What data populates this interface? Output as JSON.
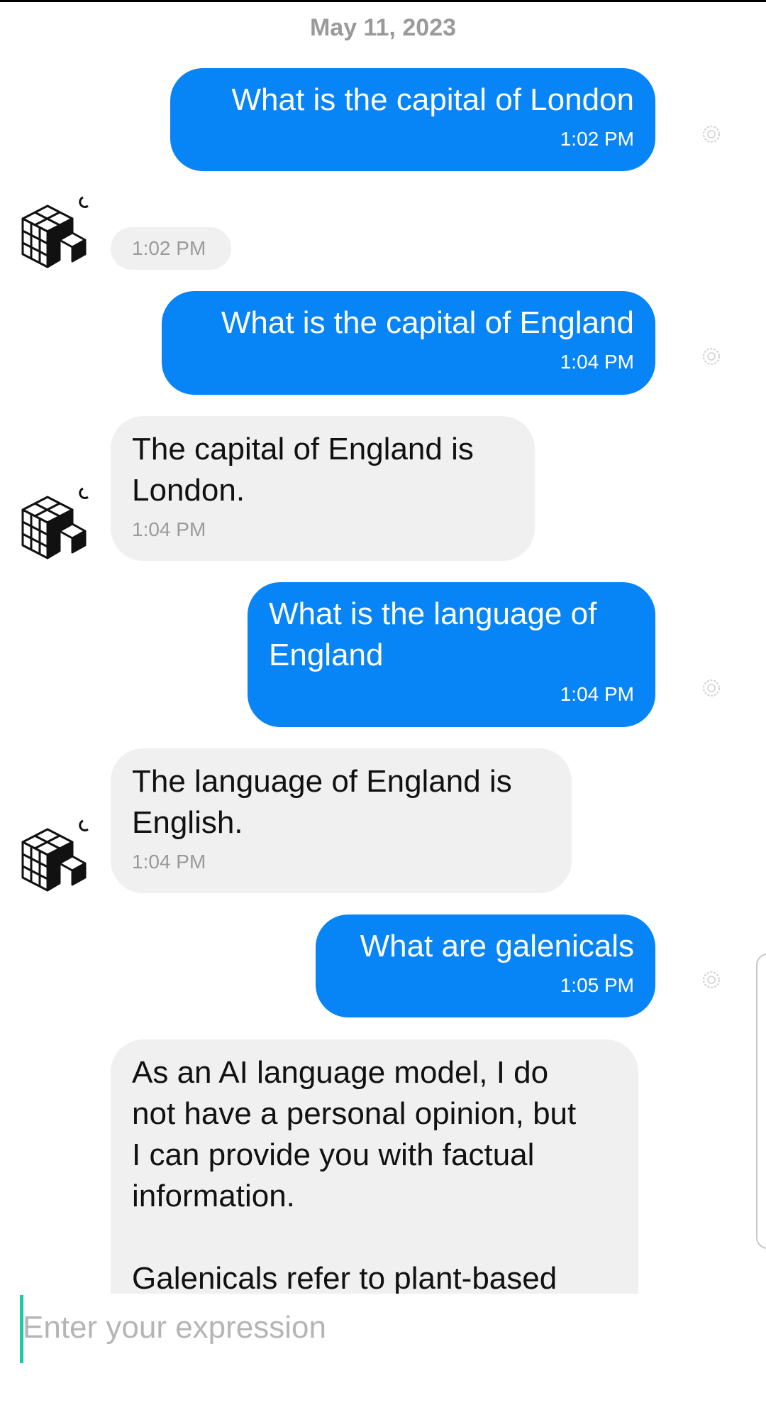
{
  "chat": {
    "date_header": "May 11, 2023",
    "messages": [
      {
        "sender": "user",
        "text": "What is the capital of London",
        "time": "1:02 PM"
      },
      {
        "sender": "bot",
        "text": "",
        "time": "1:02 PM"
      },
      {
        "sender": "user",
        "text": "What is the capital of England",
        "time": "1:04 PM"
      },
      {
        "sender": "bot",
        "text": "The capital of England is\nLondon.",
        "time": "1:04 PM"
      },
      {
        "sender": "user",
        "text": "What is the language of\nEngland",
        "time": "1:04 PM"
      },
      {
        "sender": "bot",
        "text": "The language of England is\nEnglish.",
        "time": "1:04 PM"
      },
      {
        "sender": "user",
        "text": "What are galenicals",
        "time": "1:05 PM"
      },
      {
        "sender": "bot",
        "text": "As an AI language model, I do\nnot have a personal opinion, but\nI can provide you with factual\ninformation.\n\nGalenicals refer to plant-based",
        "time": ""
      }
    ]
  },
  "input": {
    "placeholder": "Enter your expression",
    "value": ""
  },
  "icons": {
    "bot_avatar": "cube-blocks-icon",
    "message_status": "sent-status-icon"
  },
  "colors": {
    "user_bubble": "#0784f5",
    "bot_bubble": "#f0f0f0",
    "caret": "#1ec8a8"
  }
}
